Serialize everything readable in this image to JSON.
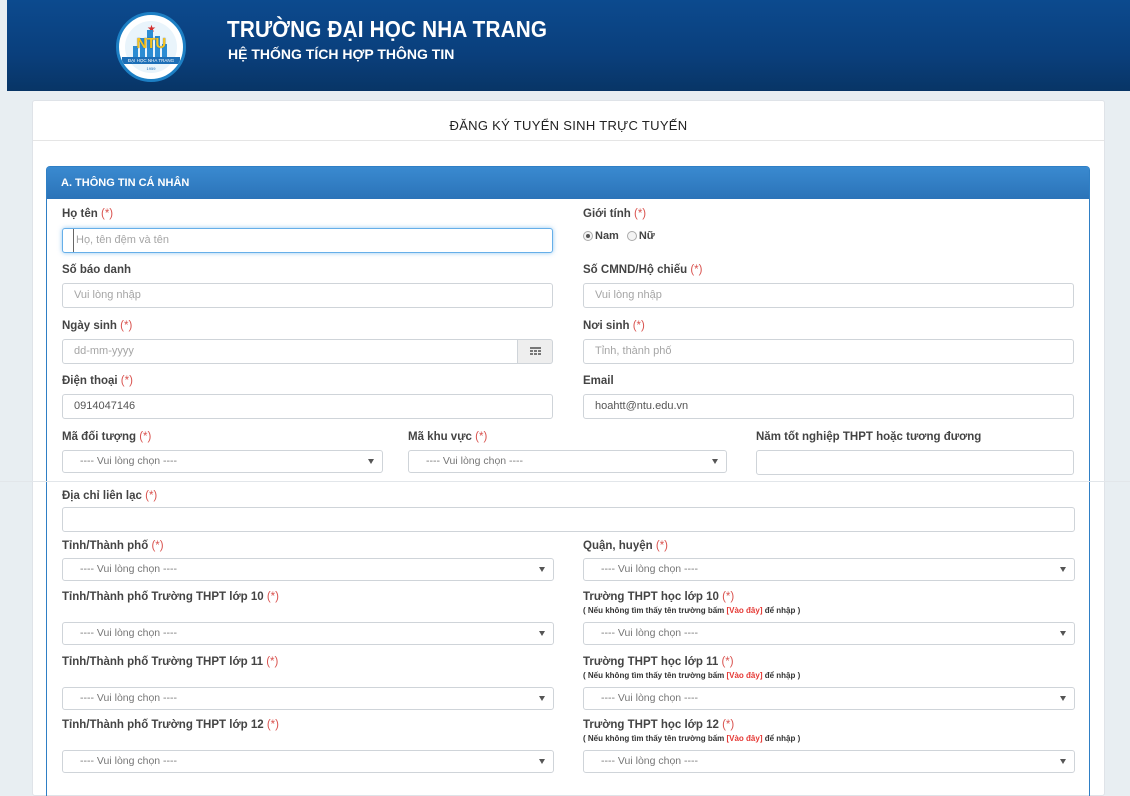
{
  "header": {
    "logo_text": "NTU",
    "logo_band": "ĐẠI HỌC NHA TRANG",
    "logo_year": "1959",
    "university": "TRƯỜNG ĐẠI HỌC NHA TRANG",
    "system": "HỆ THỐNG TÍCH HỢP THÔNG TIN"
  },
  "page_title": "ĐĂNG KÝ TUYỂN SINH TRỰC TUYẾN",
  "section_a": {
    "title": "A. THÔNG TIN CÁ NHÂN"
  },
  "required_mark": "(*)",
  "fields": {
    "ho_ten": {
      "label": "Họ tên",
      "placeholder": "Họ, tên đệm và tên"
    },
    "gioi_tinh": {
      "label": "Giới tính",
      "options": [
        "Nam",
        "Nữ"
      ],
      "selected": "Nam"
    },
    "so_bao_danh": {
      "label": "Số báo danh",
      "placeholder": "Vui lòng nhập"
    },
    "cmnd": {
      "label": "Số CMND/Hộ chiếu",
      "placeholder": "Vui lòng nhập"
    },
    "ngay_sinh": {
      "label": "Ngày sinh",
      "placeholder": "dd-mm-yyyy"
    },
    "noi_sinh": {
      "label": "Nơi sinh",
      "placeholder": "Tỉnh, thành phố"
    },
    "dien_thoai": {
      "label": "Điện thoại",
      "value": "0914047146"
    },
    "email": {
      "label": "Email",
      "value": "hoahtt@ntu.edu.vn"
    },
    "ma_doi_tuong": {
      "label": "Mã đối tượng",
      "value": "---- Vui lòng chọn ----"
    },
    "ma_khu_vuc": {
      "label": "Mã khu vực",
      "value": "---- Vui lòng chọn ----"
    },
    "nam_tot_nghiep": {
      "label": "Năm tốt nghiệp THPT hoặc tương đương",
      "value": ""
    },
    "dia_chi": {
      "label": "Địa chỉ liên lạc",
      "value": ""
    },
    "tinh_thanh": {
      "label": "Tỉnh/Thành phố",
      "value": "---- Vui lòng chọn ----"
    },
    "quan_huyen": {
      "label": "Quận, huyện",
      "value": "---- Vui lòng chọn ----"
    },
    "tinh_lop10": {
      "label": "Tỉnh/Thành phố Trường THPT lớp 10",
      "value": "---- Vui lòng chọn ----"
    },
    "truong_lop10": {
      "label": "Trường THPT học lớp 10",
      "value": "---- Vui lòng chọn ----"
    },
    "tinh_lop11": {
      "label": "Tỉnh/Thành phố Trường THPT lớp 11",
      "value": "---- Vui lòng chọn ----"
    },
    "truong_lop11": {
      "label": "Trường THPT học lớp 11",
      "value": "---- Vui lòng chọn ----"
    },
    "tinh_lop12": {
      "label": "Tỉnh/Thành phố Trường THPT lớp 12",
      "value": "---- Vui lòng chọn ----"
    },
    "truong_lop12": {
      "label": "Trường THPT học lớp 12",
      "value": "---- Vui lòng chọn ----"
    }
  },
  "school_note": {
    "prefix": "( Nếu không tìm thấy tên trường bấm ",
    "link": "[Vào đây]",
    "suffix": " để nhập )"
  },
  "colors": {
    "header": "#0c4a8e",
    "section_head": "#2f7fc5",
    "required": "#d9534f"
  }
}
